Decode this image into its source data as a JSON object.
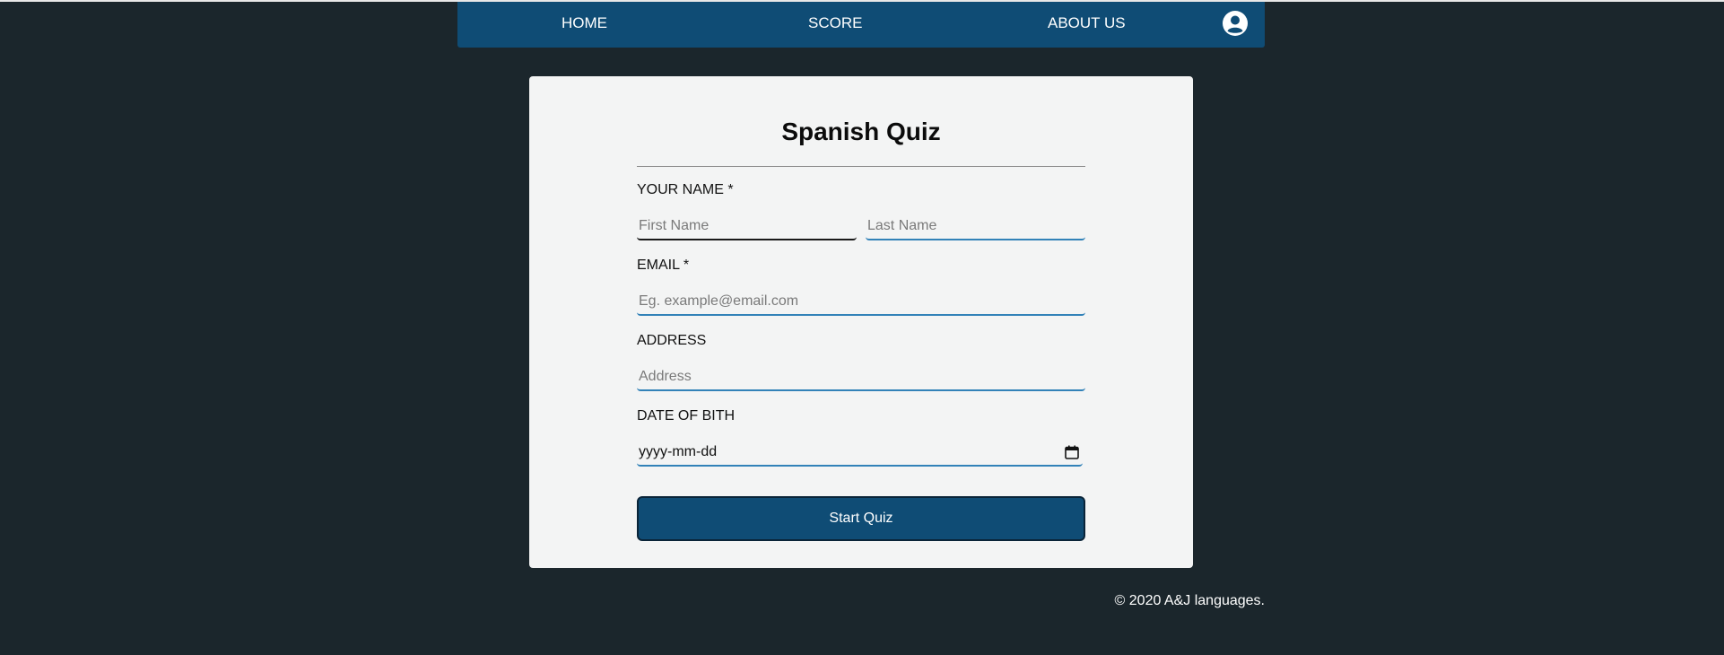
{
  "nav": {
    "home": "HOME",
    "score": "SCORE",
    "about": "ABOUT US",
    "account_icon": "user-circle-icon"
  },
  "form": {
    "title": "Spanish Quiz",
    "name_label": "YOUR NAME *",
    "first_name_placeholder": "First Name",
    "last_name_placeholder": "Last Name",
    "email_label": "EMAIL *",
    "email_placeholder": "Eg. example@email.com",
    "address_label": "ADDRESS",
    "address_placeholder": "Address",
    "dob_label": "DATE OF BITH",
    "dob_placeholder": "yyyy-mm-dd",
    "calendar_icon": "calendar-icon",
    "submit_label": "Start Quiz"
  },
  "footer": {
    "text": "© 2020 A&J languages."
  },
  "colors": {
    "page_background": "#1b262c",
    "navbar": "#0f4c75",
    "card": "#f3f4f4",
    "input_underline": "#3282b8",
    "button": "#0f4c75"
  }
}
